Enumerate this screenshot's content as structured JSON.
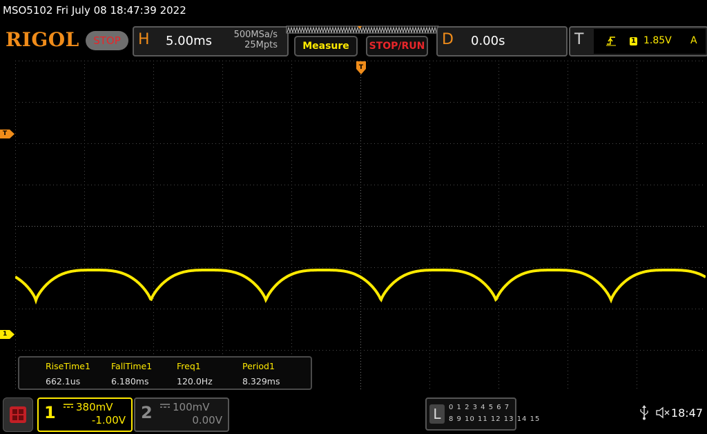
{
  "header": {
    "title": "MSO5102  Fri July 08 18:47:39 2022",
    "logo": "RIGOL",
    "run_state": "STOP"
  },
  "horizontal": {
    "letter": "H",
    "timebase": "5.00ms",
    "sample_rate": "500MSa/s",
    "memory_depth": "25Mpts"
  },
  "buttons": {
    "measure_label": "Measure",
    "stoprun_label": "STOP/RUN"
  },
  "delay": {
    "letter": "D",
    "value": "0.00s"
  },
  "trigger": {
    "letter": "T",
    "channel": "1",
    "level": "1.85V",
    "mode": "A",
    "marker_label": "T"
  },
  "markers": {
    "ch1_label": "1"
  },
  "measurements": [
    {
      "name": "RiseTime1",
      "value": "662.1us"
    },
    {
      "name": "FallTime1",
      "value": "6.180ms"
    },
    {
      "name": "Freq1",
      "value": "120.0Hz"
    },
    {
      "name": "Period1",
      "value": "8.329ms"
    }
  ],
  "channels": {
    "ch1": {
      "number": "1",
      "scale": "380mV",
      "offset": "-1.00V"
    },
    "ch2": {
      "number": "2",
      "scale": "100mV",
      "offset": "0.00V"
    }
  },
  "logic": {
    "letter": "L",
    "row1": "0 1 2 3  4 5 6 7",
    "row2": "8 9 10 11 12 13 14 15"
  },
  "status": {
    "clock": "18:47"
  },
  "colors": {
    "ch1": "#ffea00",
    "accent": "#f08c1a",
    "stop": "#e8262a"
  }
}
